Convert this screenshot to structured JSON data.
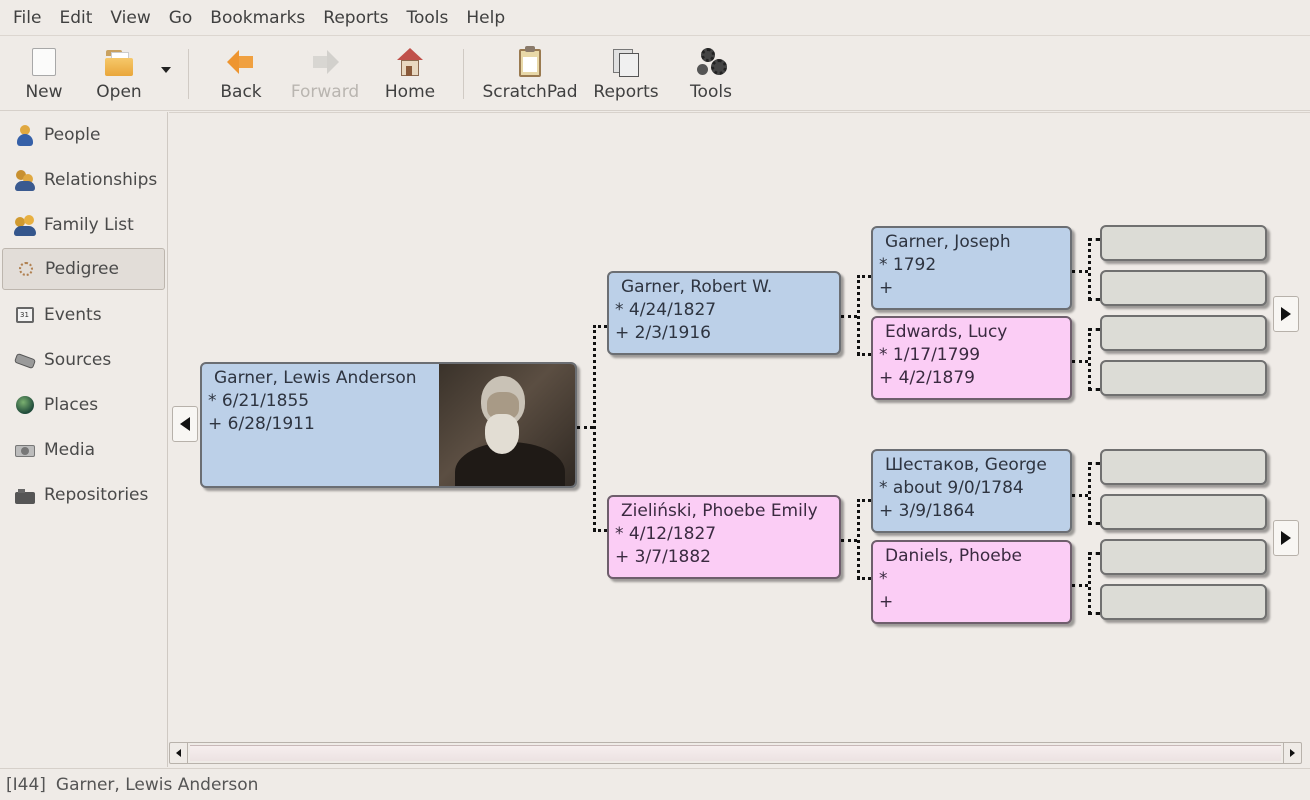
{
  "menubar": {
    "items": [
      "File",
      "Edit",
      "View",
      "Go",
      "Bookmarks",
      "Reports",
      "Tools",
      "Help"
    ]
  },
  "toolbar": {
    "new": "New",
    "open": "Open",
    "back": "Back",
    "forward": "Forward",
    "home": "Home",
    "scratchpad": "ScratchPad",
    "reports": "Reports",
    "tools": "Tools"
  },
  "sidebar": {
    "items": [
      {
        "label": "People",
        "icon": "people-icon"
      },
      {
        "label": "Relationships",
        "icon": "relationships-icon"
      },
      {
        "label": "Family List",
        "icon": "family-list-icon"
      },
      {
        "label": "Pedigree",
        "icon": "pedigree-icon",
        "active": true
      },
      {
        "label": "Events",
        "icon": "events-icon"
      },
      {
        "label": "Sources",
        "icon": "sources-icon"
      },
      {
        "label": "Places",
        "icon": "places-icon"
      },
      {
        "label": "Media",
        "icon": "media-icon"
      },
      {
        "label": "Repositories",
        "icon": "repositories-icon"
      }
    ]
  },
  "pedigree": {
    "root": {
      "name": "Garner, Lewis Anderson",
      "birth": "* 6/21/1855",
      "death": "+ 6/28/1911",
      "gender": "male",
      "has_photo": true
    },
    "father": {
      "name": "Garner, Robert W.",
      "birth": "* 4/24/1827",
      "death": "+ 2/3/1916",
      "gender": "male"
    },
    "mother": {
      "name": "Zieliński, Phoebe Emily",
      "birth": "* 4/12/1827",
      "death": "+ 3/7/1882",
      "gender": "female"
    },
    "paternal_grandfather": {
      "name": "Garner, Joseph",
      "birth": "* 1792",
      "death": "+",
      "gender": "male"
    },
    "paternal_grandmother": {
      "name": "Edwards, Lucy",
      "birth": "* 1/17/1799",
      "death": "+ 4/2/1879",
      "gender": "female"
    },
    "maternal_grandfather": {
      "name": "Шестаков, George",
      "birth": "* about 9/0/1784",
      "death": "+ 3/9/1864",
      "gender": "male"
    },
    "maternal_grandmother": {
      "name": "Daniels, Phoebe",
      "birth": "*",
      "death": "+",
      "gender": "female"
    }
  },
  "statusbar": {
    "id": "[I44]",
    "name": "Garner, Lewis Anderson"
  },
  "colors": {
    "male": "#bcd0e8",
    "female": "#fbcdf5",
    "empty": "#dcdcd6",
    "background": "#efebe7"
  }
}
